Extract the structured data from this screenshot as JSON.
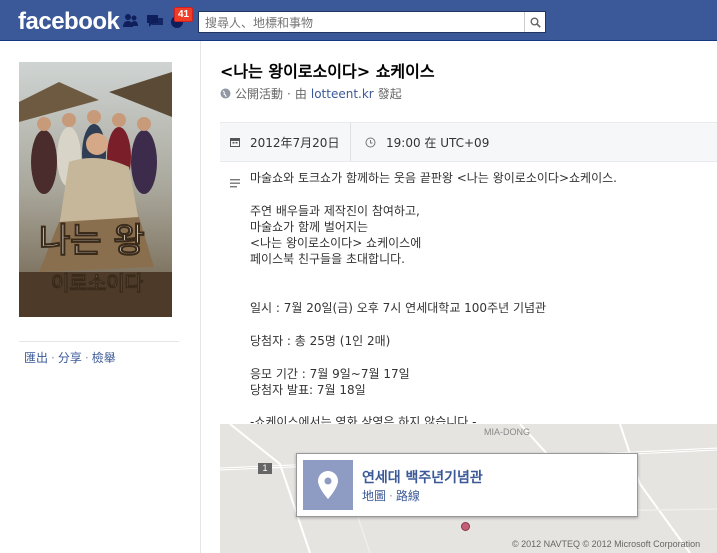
{
  "header": {
    "logo": "facebook",
    "notification_count": "41",
    "search_placeholder": "搜尋人、地標和事物"
  },
  "sidebar": {
    "poster_title_line1": "나는 왕",
    "poster_title_line2": "이로소이다",
    "actions": [
      "匯出",
      "分享",
      "檢舉"
    ]
  },
  "event": {
    "title": "<나는 왕이로소이다> 쇼케이스",
    "visibility": "公開活動",
    "by_prefix": "由",
    "host": "lotteent.kr",
    "host_suffix": "發起",
    "date": "2012年7月20日",
    "time": "19:00 在 UTC+09",
    "description": "마술쇼와 토크쇼가 함께하는 웃음 끝판왕 <나는 왕이로소이다>쇼케이스.\n\n주연 배우들과 제작진이 참여하고,\n마술쇼가 함께 벌어지는\n<나는 왕이로소이다> 쇼케이스에\n페이스북 친구들을 초대합니다.\n\n\n일시 : 7월 20일(금) 오후 7시 연세대학교 100주년 기념관\n\n당첨자 : 총 25명 (1인 2매)\n\n응모 기간 : 7월 9일~7월 17일\n당첨자 발표: 7월 18일\n\n-쇼케이스에서는 영화 상영은 하지 않습니다.-"
  },
  "map": {
    "area_label": "MIA-DONG",
    "road_number": "1",
    "venue_name": "연세대 백주년기념관",
    "link_map": "地圖",
    "link_route": "路線",
    "copyright": "© 2012 NAVTEQ © 2012 Microsoft Corporation"
  }
}
